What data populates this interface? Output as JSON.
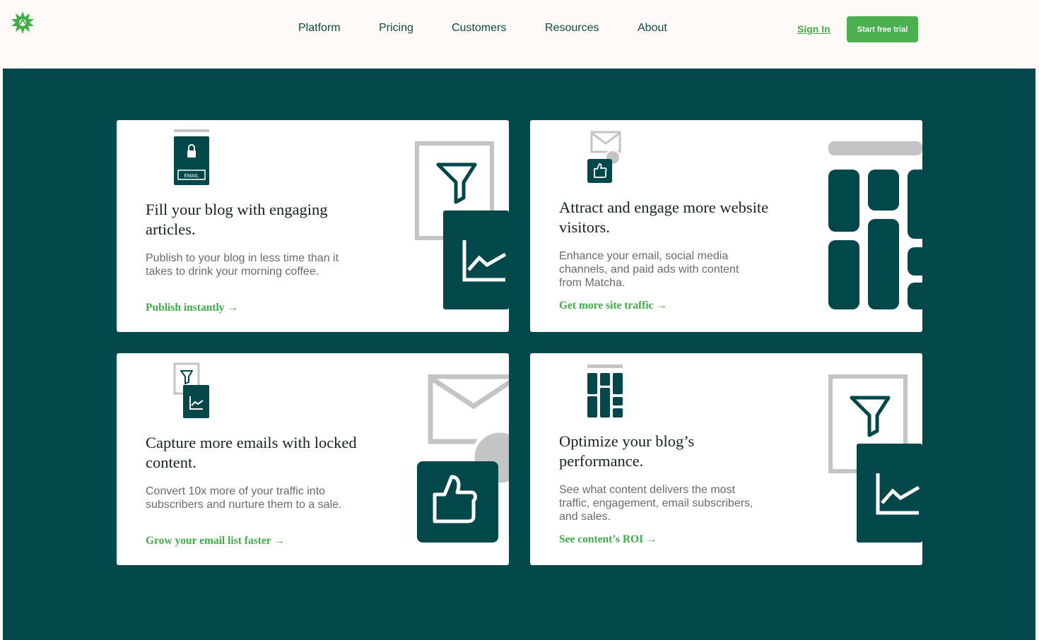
{
  "brand": {
    "logo": "matcha-star-logo"
  },
  "nav": {
    "items": [
      {
        "label": "Platform"
      },
      {
        "label": "Pricing"
      },
      {
        "label": "Customers"
      },
      {
        "label": "Resources"
      },
      {
        "label": "About"
      }
    ],
    "signin_label": "Sign In",
    "cta_label": "Start free trial"
  },
  "colors": {
    "hero_bg": "#02484b",
    "accent_green": "#4caf50",
    "dark_teal": "#02484b",
    "page_bg": "#fffaf5"
  },
  "cards": [
    {
      "title": "Fill your blog with engaging articles.",
      "desc": "Publish to your blog in less time than it takes to drink your morning coffee.",
      "link": "Publish instantly",
      "arrow": "→",
      "icon": "lock-email-icon",
      "art": "funnel-chart-art",
      "icon_label": "EMAIL"
    },
    {
      "title": "Attract and engage more website visitors.",
      "desc": "Enhance your email, social media channels, and paid ads with content from Matcha.",
      "link": "Get more site traffic",
      "arrow": "→",
      "icon": "mail-thumbs-up-icon",
      "art": "grid-blocks-art"
    },
    {
      "title": "Capture more emails with locked content.",
      "desc": "Convert 10x more of your traffic into subscribers and nurture them to a sale.",
      "link": "Grow your email list faster",
      "arrow": "→",
      "icon": "funnel-chart-icon",
      "art": "mail-thumbs-up-art"
    },
    {
      "title": "Optimize your blog’s performance.",
      "desc": "See what content delivers the most traffic, engagement, email subscribers, and sales.",
      "link": "See content’s ROI",
      "arrow": "→",
      "icon": "grid-blocks-icon",
      "art": "funnel-chart-art"
    }
  ]
}
